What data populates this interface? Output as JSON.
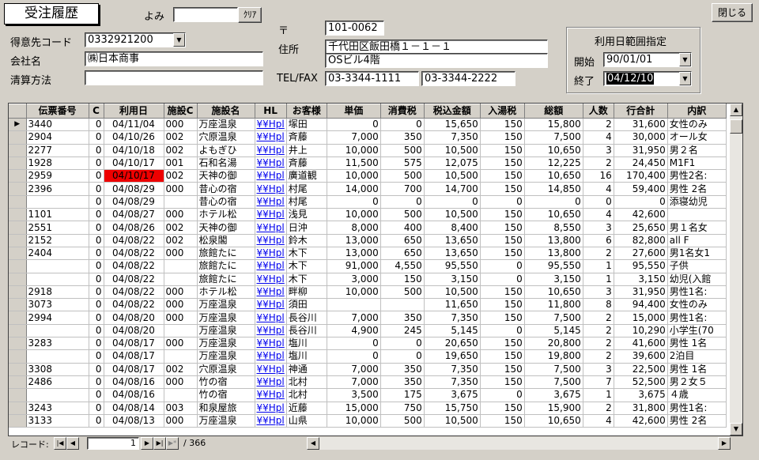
{
  "header": {
    "title": "受注履歴",
    "yomi_label": "よみ",
    "yomi_value": "",
    "clear_label": "ｸﾘｱ",
    "close_label": "閉じる",
    "customer_code_label": "得意先コード",
    "customer_code": "0332921200",
    "company_label": "会社名",
    "company": "㈱日本商事",
    "payment_label": "清算方法",
    "payment": "",
    "postal_mark": "〒",
    "postal": "101-0062",
    "address_label": "住所",
    "address1": "千代田区飯田橋１－１－１",
    "address2": "OSビル4階",
    "telfax_label": "TEL/FAX",
    "tel": "03-3344-1111",
    "fax": "03-3344-2222"
  },
  "date_range": {
    "title": "利用日範囲指定",
    "start_label": "開始",
    "start": "90/01/01",
    "end_label": "終了",
    "end": "04/12/10"
  },
  "table": {
    "columns": [
      "伝票番号",
      "C",
      "利用日",
      "施設C",
      "施設名",
      "HL",
      "お客様",
      "単価",
      "消費税",
      "税込金額",
      "入湯税",
      "総額",
      "人数",
      "行合計",
      "内訳"
    ],
    "rows": [
      [
        "3440",
        "0",
        "04/11/04",
        "000",
        "万座温泉",
        "¥¥Hpl",
        "塚田",
        "0",
        "0",
        "15,650",
        "150",
        "15,800",
        "2",
        "31,600",
        "女性のみ"
      ],
      [
        "2904",
        "0",
        "04/10/26",
        "002",
        "穴原温泉",
        "¥¥Hpl",
        "斉藤",
        "7,000",
        "350",
        "7,350",
        "150",
        "7,500",
        "4",
        "30,000",
        "オール女"
      ],
      [
        "2277",
        "0",
        "04/10/18",
        "002",
        "よもぎひ",
        "¥¥Hpl",
        "井上",
        "10,000",
        "500",
        "10,500",
        "150",
        "10,650",
        "3",
        "31,950",
        "男２名"
      ],
      [
        "1928",
        "0",
        "04/10/17",
        "001",
        "石和名湯",
        "¥¥Hpl",
        "斉藤",
        "11,500",
        "575",
        "12,075",
        "150",
        "12,225",
        "2",
        "24,450",
        "M1F1"
      ],
      [
        "2959",
        "0",
        "04/10/17",
        "002",
        "天神の御",
        "¥¥Hpl",
        "廣道観",
        "10,000",
        "500",
        "10,500",
        "150",
        "10,650",
        "16",
        "170,400",
        "男性2名:"
      ],
      [
        "2396",
        "0",
        "04/08/29",
        "000",
        "昔心の宿",
        "¥¥Hpl",
        "村尾",
        "14,000",
        "700",
        "14,700",
        "150",
        "14,850",
        "4",
        "59,400",
        "男性 2名"
      ],
      [
        "",
        "0",
        "04/08/29",
        "",
        "昔心の宿",
        "¥¥Hpl",
        "村尾",
        "0",
        "0",
        "0",
        "0",
        "0",
        "0",
        "0",
        "添寝幼児"
      ],
      [
        "1101",
        "0",
        "04/08/27",
        "000",
        "ホテル松",
        "¥¥Hpl",
        "浅見",
        "10,000",
        "500",
        "10,500",
        "150",
        "10,650",
        "4",
        "42,600",
        ""
      ],
      [
        "2551",
        "0",
        "04/08/26",
        "002",
        "天神の御",
        "¥¥Hpl",
        "日沖",
        "8,000",
        "400",
        "8,400",
        "150",
        "8,550",
        "3",
        "25,650",
        "男１名女"
      ],
      [
        "2152",
        "0",
        "04/08/22",
        "002",
        "松泉閣",
        "¥¥Hpl",
        "鈴木",
        "13,000",
        "650",
        "13,650",
        "150",
        "13,800",
        "6",
        "82,800",
        "all F"
      ],
      [
        "2404",
        "0",
        "04/08/22",
        "000",
        "旅館たに",
        "¥¥Hpl",
        "木下",
        "13,000",
        "650",
        "13,650",
        "150",
        "13,800",
        "2",
        "27,600",
        "男1名女1"
      ],
      [
        "",
        "0",
        "04/08/22",
        "",
        "旅館たに",
        "¥¥Hpl",
        "木下",
        "91,000",
        "4,550",
        "95,550",
        "0",
        "95,550",
        "1",
        "95,550",
        "子供"
      ],
      [
        "",
        "0",
        "04/08/22",
        "",
        "旅館たに",
        "¥¥Hpl",
        "木下",
        "3,000",
        "150",
        "3,150",
        "0",
        "3,150",
        "1",
        "3,150",
        "幼児(入館"
      ],
      [
        "2918",
        "0",
        "04/08/22",
        "000",
        "ホテル松",
        "¥¥Hpl",
        "畔柳",
        "10,000",
        "500",
        "10,500",
        "150",
        "10,650",
        "3",
        "31,950",
        "男性1名:"
      ],
      [
        "3073",
        "0",
        "04/08/22",
        "000",
        "万座温泉",
        "¥¥Hpl",
        "須田",
        "",
        "",
        "11,650",
        "150",
        "11,800",
        "8",
        "94,400",
        "女性のみ"
      ],
      [
        "2994",
        "0",
        "04/08/20",
        "000",
        "万座温泉",
        "¥¥Hpl",
        "長谷川",
        "7,000",
        "350",
        "7,350",
        "150",
        "7,500",
        "2",
        "15,000",
        "男性1名:"
      ],
      [
        "",
        "0",
        "04/08/20",
        "",
        "万座温泉",
        "¥¥Hpl",
        "長谷川",
        "4,900",
        "245",
        "5,145",
        "0",
        "5,145",
        "2",
        "10,290",
        "小学生(70"
      ],
      [
        "3283",
        "0",
        "04/08/17",
        "000",
        "万座温泉",
        "¥¥Hpl",
        "塩川",
        "0",
        "0",
        "20,650",
        "150",
        "20,800",
        "2",
        "41,600",
        "男性 1名"
      ],
      [
        "",
        "0",
        "04/08/17",
        "",
        "万座温泉",
        "¥¥Hpl",
        "塩川",
        "0",
        "0",
        "19,650",
        "150",
        "19,800",
        "2",
        "39,600",
        "2泊目"
      ],
      [
        "3308",
        "0",
        "04/08/17",
        "002",
        "穴原温泉",
        "¥¥Hpl",
        "神通",
        "7,000",
        "350",
        "7,350",
        "150",
        "7,500",
        "3",
        "22,500",
        "男性 1名"
      ],
      [
        "2486",
        "0",
        "04/08/16",
        "000",
        "竹の宿",
        "¥¥Hpl",
        "北村",
        "7,000",
        "350",
        "7,350",
        "150",
        "7,500",
        "7",
        "52,500",
        "男２女５"
      ],
      [
        "",
        "0",
        "04/08/16",
        "",
        "竹の宿",
        "¥¥Hpl",
        "北村",
        "3,500",
        "175",
        "3,675",
        "0",
        "3,675",
        "1",
        "3,675",
        "４歳"
      ],
      [
        "3243",
        "0",
        "04/08/14",
        "003",
        "和泉屋旅",
        "¥¥Hpl",
        "近藤",
        "15,000",
        "750",
        "15,750",
        "150",
        "15,900",
        "2",
        "31,800",
        "男性1名:"
      ],
      [
        "3133",
        "0",
        "04/08/13",
        "000",
        "万座温泉",
        "¥¥Hpl",
        "山県",
        "10,000",
        "500",
        "10,500",
        "150",
        "10,650",
        "4",
        "42,600",
        "男性 2名"
      ]
    ]
  },
  "navigator": {
    "label": "レコード:",
    "current": "1",
    "of_label": "/ 366"
  },
  "colors": {
    "flag_red": "#ee0000",
    "link": "#0000ee"
  }
}
